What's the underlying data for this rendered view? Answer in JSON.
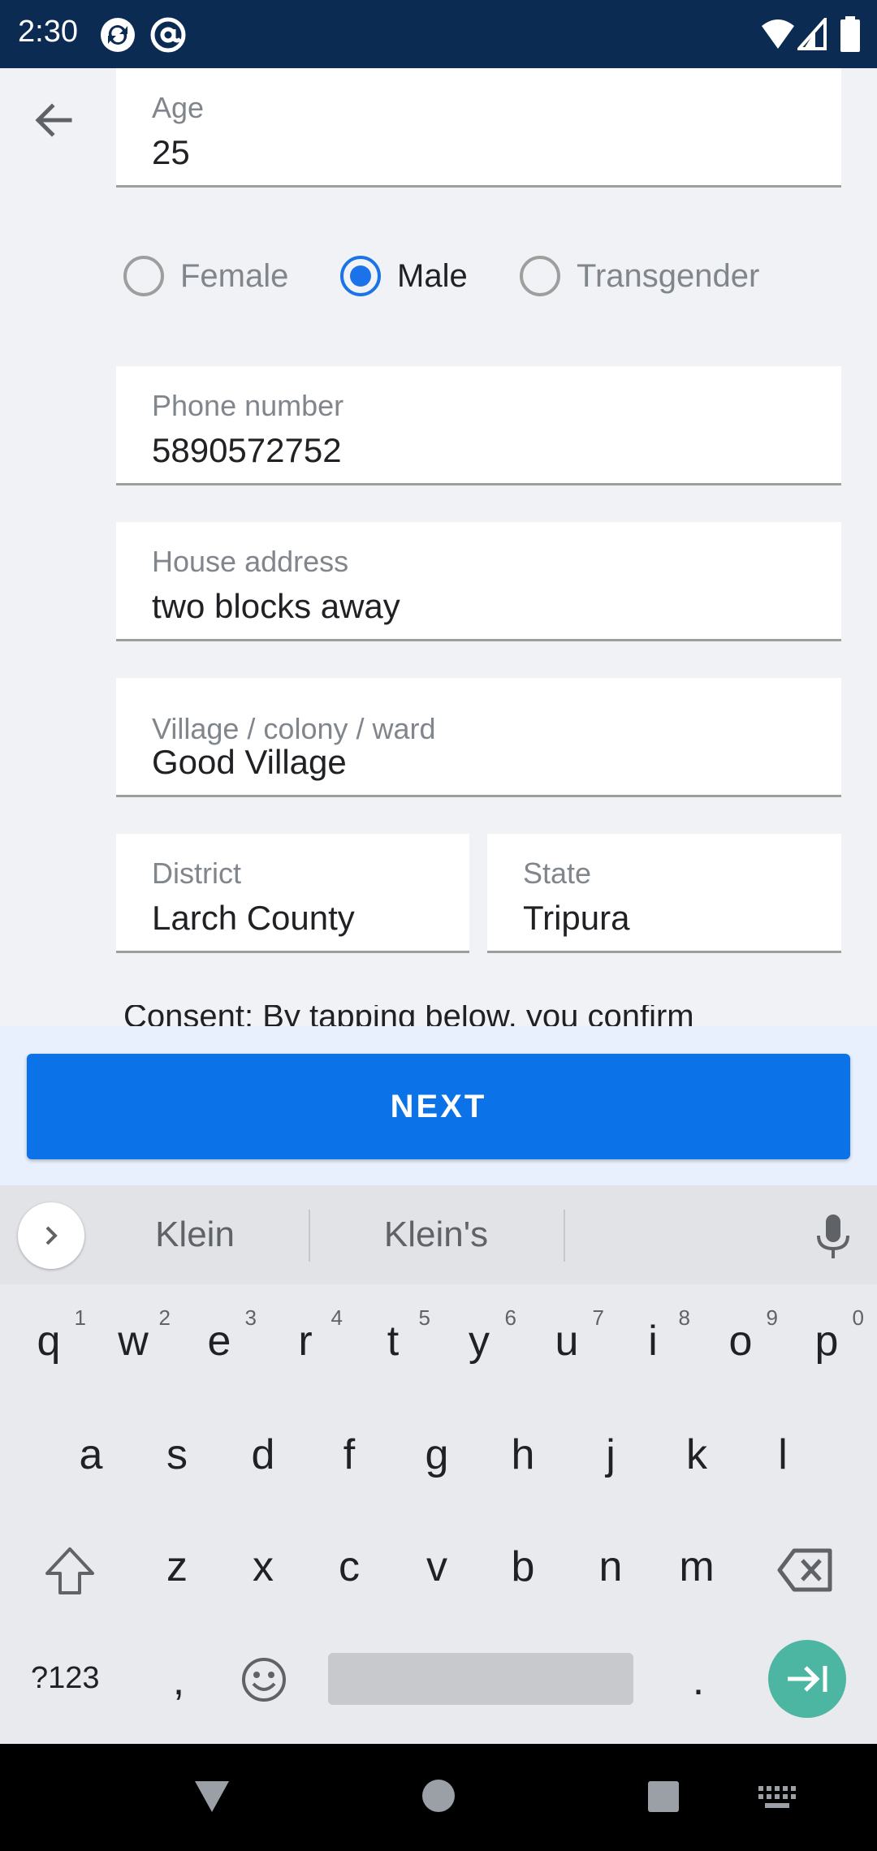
{
  "status_bar": {
    "time": "2:30",
    "icons": [
      "sync-icon",
      "at-sign-icon",
      "wifi-icon",
      "signal-icon",
      "battery-icon"
    ]
  },
  "form": {
    "back_icon": "arrow-back-icon",
    "age": {
      "label": "Age",
      "value": "25"
    },
    "gender": {
      "options": [
        "Female",
        "Male",
        "Transgender"
      ],
      "selected": "Male"
    },
    "phone": {
      "label": "Phone number",
      "value": "5890572752"
    },
    "house_address": {
      "label": "House address",
      "value": "two blocks away"
    },
    "village": {
      "label": "Village / colony / ward",
      "value": "Good Village"
    },
    "district": {
      "label": "District",
      "value": "Larch County"
    },
    "state": {
      "label": "State",
      "value": "Tripura"
    },
    "consent_text": "Consent: By tapping below, you confirm",
    "next_label": "NEXT"
  },
  "keyboard": {
    "suggestions": [
      "Klein",
      "Klein's"
    ],
    "row1": [
      "q",
      "w",
      "e",
      "r",
      "t",
      "y",
      "u",
      "i",
      "o",
      "p"
    ],
    "row1_hints": [
      "1",
      "2",
      "3",
      "4",
      "5",
      "6",
      "7",
      "8",
      "9",
      "0"
    ],
    "row2": [
      "a",
      "s",
      "d",
      "f",
      "g",
      "h",
      "j",
      "k",
      "l"
    ],
    "row3": [
      "z",
      "x",
      "c",
      "v",
      "b",
      "n",
      "m"
    ],
    "symbols_key": "?123",
    "comma_key": ",",
    "period_key": "."
  },
  "colors": {
    "accent": "#1a73e8",
    "next_button": "#0b72e7",
    "status_bar": "#0b2b52",
    "enter_key": "#4cb6a2"
  }
}
